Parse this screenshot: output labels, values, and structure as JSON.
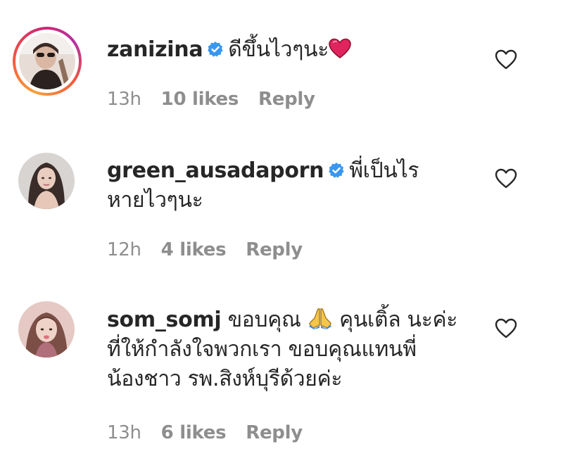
{
  "comments": [
    {
      "username": "zanizina",
      "verified": true,
      "text_before_emoji": "ดีขึ้นไวๆนะ",
      "emoji": "red-heart",
      "time": "13h",
      "likes": "10 likes",
      "reply": "Reply",
      "story_ring": true
    },
    {
      "username": "green_ausadaporn",
      "verified": true,
      "text_line1": "พี่เป็นไร",
      "text_line2": "หายไวๆนะ",
      "time": "12h",
      "likes": "4 likes",
      "reply": "Reply",
      "story_ring": false
    },
    {
      "username": "som_somj",
      "verified": false,
      "text_part1": "ขอบคุณ",
      "emoji": "folded-hands",
      "text_part2": "คุนเติ้ล นะค่ะ",
      "text_line2": "ที่ให้กำลังใจพวกเรา ขอบคุณแทนพี่",
      "text_line3": "น้องชาว รพ.สิงห์บุรีด้วยค่ะ",
      "time": "13h",
      "likes": "6 likes",
      "reply": "Reply",
      "story_ring": false
    }
  ],
  "colors": {
    "text": "#262626",
    "meta": "#8e8e8e",
    "verified": "#3897f0",
    "heart_emoji": "#e0245e"
  },
  "icons": {
    "like": "heart-outline-icon",
    "verified": "verified-badge-icon"
  }
}
